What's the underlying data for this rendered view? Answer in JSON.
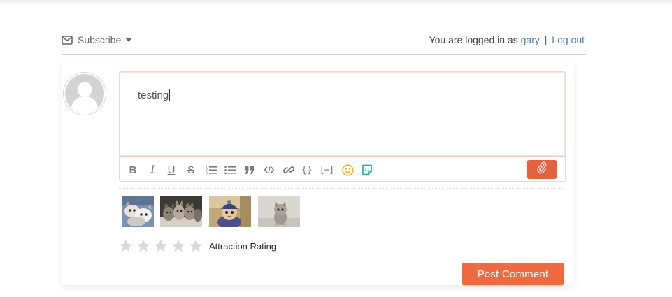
{
  "header": {
    "subscribe_label": "Subscribe",
    "logged_in_text": "You are logged in as",
    "username": "gary",
    "separator": "|",
    "logout_label": "Log out"
  },
  "editor": {
    "text": "testing",
    "toolbar_items": [
      {
        "name": "bold-icon",
        "glyph": "B"
      },
      {
        "name": "italic-icon",
        "glyph": "I"
      },
      {
        "name": "underline-icon",
        "glyph": "U"
      },
      {
        "name": "strikethrough-icon",
        "glyph": "S"
      },
      {
        "name": "ordered-list-icon"
      },
      {
        "name": "unordered-list-icon"
      },
      {
        "name": "blockquote-icon"
      },
      {
        "name": "code-icon"
      },
      {
        "name": "link-icon"
      },
      {
        "name": "code-block-icon",
        "glyph": "{}"
      },
      {
        "name": "spoiler-icon",
        "glyph": "[+]"
      },
      {
        "name": "emoji-icon"
      },
      {
        "name": "sticker-icon"
      }
    ],
    "attach_icon": "paperclip-icon"
  },
  "thumbnails": [
    {
      "name": "thumbnail-kittens-1"
    },
    {
      "name": "thumbnail-kittens-2"
    },
    {
      "name": "thumbnail-cat-hat"
    },
    {
      "name": "thumbnail-kitten-grey"
    }
  ],
  "rating": {
    "stars_total": 5,
    "stars_filled": 0,
    "label": "Attraction Rating"
  },
  "submit": {
    "label": "Post Comment"
  },
  "colors": {
    "accent": "#ef6a40",
    "attach": "#e5623f",
    "link": "#4a7fb6",
    "star_empty": "#d9d9d9",
    "emoji": "#f2b21b",
    "sticker": "#1eb3a0"
  }
}
